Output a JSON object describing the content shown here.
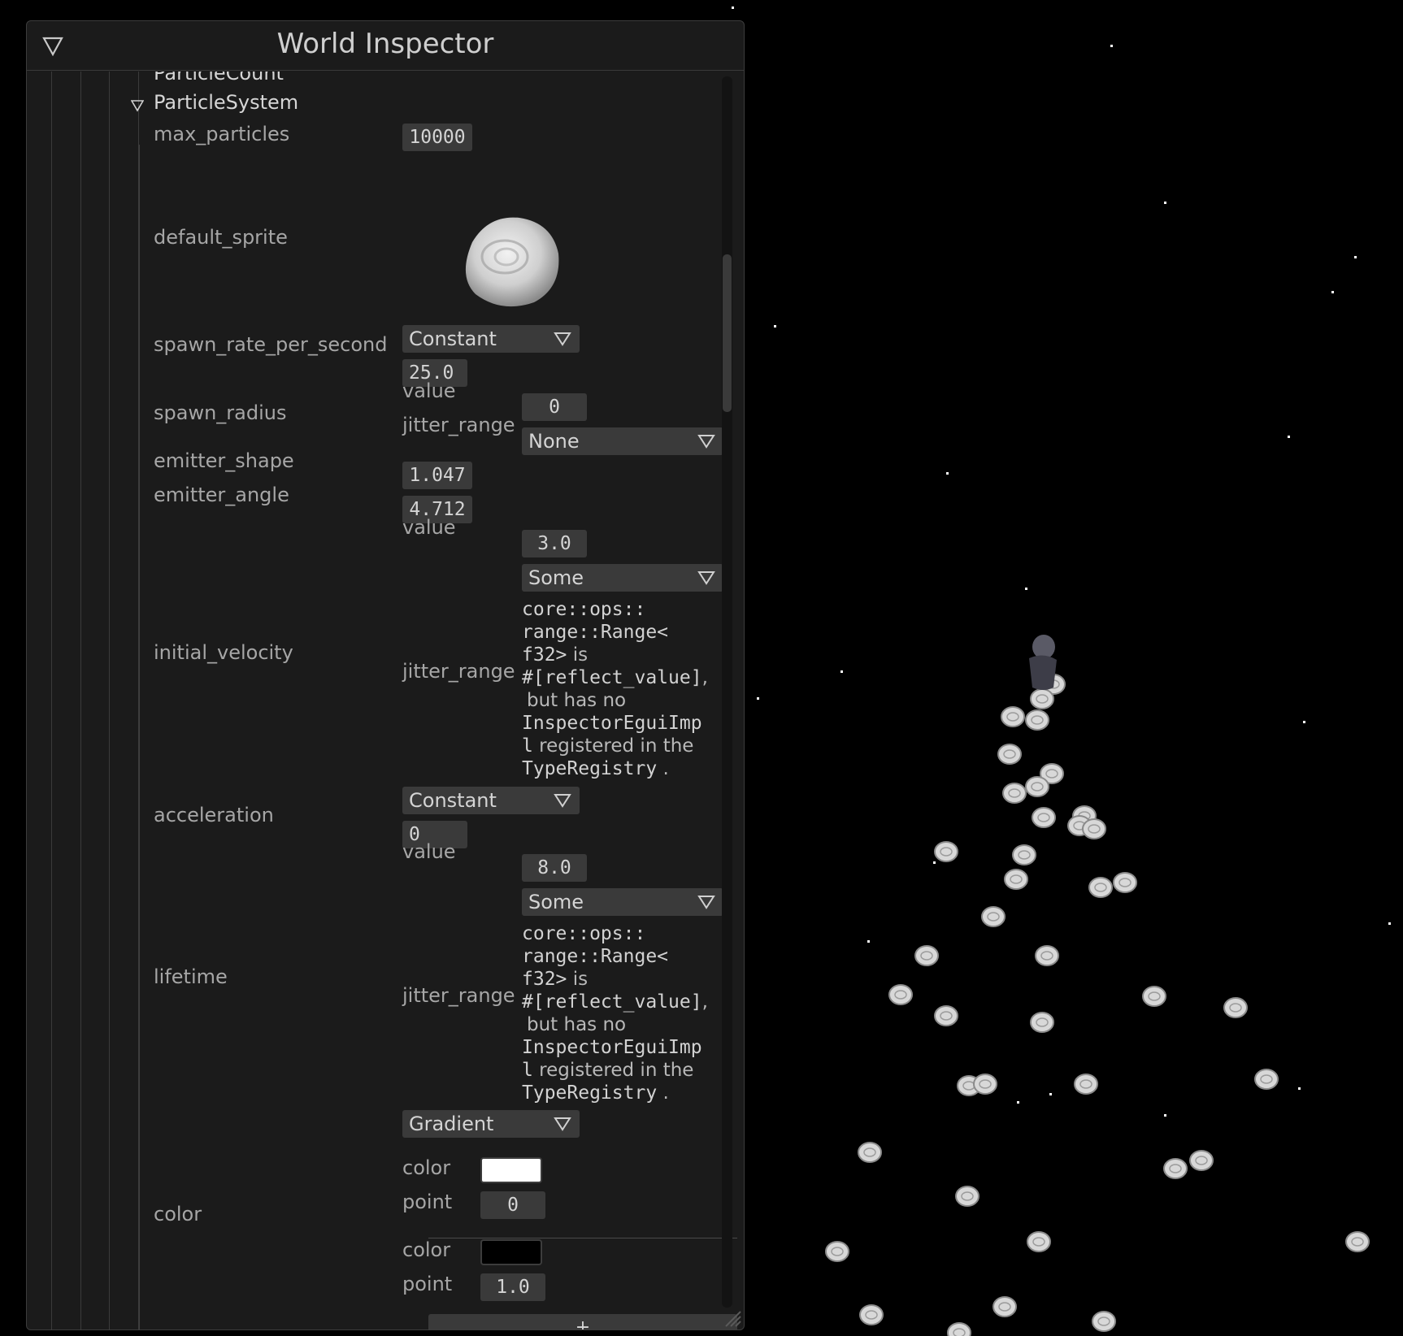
{
  "window": {
    "title": "World Inspector"
  },
  "partial_header": "ParticleCount",
  "component": {
    "name": "ParticleSystem"
  },
  "fields": {
    "max_particles": {
      "label": "max_particles",
      "value": "10000"
    },
    "default_sprite": {
      "label": "default_sprite"
    },
    "spawn_rate_per_second": {
      "label": "spawn_rate_per_second",
      "mode": "Constant",
      "value": "25.0"
    },
    "spawn_radius": {
      "label": "spawn_radius",
      "value_label": "value",
      "value": "0",
      "jitter_label": "jitter_range",
      "jitter_option": "None"
    },
    "emitter_shape": {
      "label": "emitter_shape",
      "value": "1.047"
    },
    "emitter_angle": {
      "label": "emitter_angle",
      "value": "4.712"
    },
    "initial_velocity": {
      "label": "initial_velocity",
      "value_label": "value",
      "value": "3.0",
      "jitter_label": "jitter_range",
      "jitter_option": "Some",
      "warning": {
        "type_l1": "core::ops::",
        "type_l2": "range::Range<",
        "type_l3": "f32>",
        "is": " is",
        "attr": "#[reflect_value]",
        "comma": ",",
        "but": "but has no",
        "impl_l1": "InspectorEguiImp",
        "impl_l2": "l",
        "registered": " registered in the",
        "registry": "TypeRegistry",
        "dot": " ."
      }
    },
    "acceleration": {
      "label": "acceleration",
      "mode": "Constant",
      "value": "0"
    },
    "lifetime": {
      "label": "lifetime",
      "value_label": "value",
      "value": "8.0",
      "jitter_label": "jitter_range",
      "jitter_option": "Some",
      "warning": {
        "type_l1": "core::ops::",
        "type_l2": "range::Range<",
        "type_l3": "f32>",
        "is": " is",
        "attr": "#[reflect_value]",
        "comma": ",",
        "but": "but has no",
        "impl_l1": "InspectorEguiImp",
        "impl_l2": "l",
        "registered": " registered in the",
        "registry": "TypeRegistry",
        "dot": " ."
      }
    },
    "color": {
      "label": "color",
      "mode": "Gradient",
      "stops": [
        {
          "color_label": "color",
          "color": "#ffffff",
          "point_label": "point",
          "point": "0"
        },
        {
          "color_label": "color",
          "color": "#000000",
          "point_label": "point",
          "point": "1.0"
        }
      ],
      "add_label": "+"
    }
  },
  "colors": {
    "panel_bg": "#1b1b1b",
    "field_bg": "#3a3a3a",
    "scene_bg": "#000000",
    "particle": "#d8d8d8"
  }
}
